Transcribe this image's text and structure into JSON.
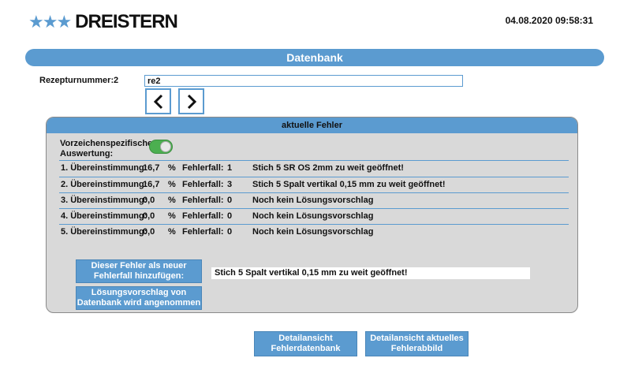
{
  "header": {
    "logo_stars": "★★★",
    "logo_text": "DREISTERN",
    "datetime": "04.08.2020 09:58:31"
  },
  "title": "Datenbank",
  "recipe": {
    "label": "Rezepturnummer:",
    "number": "2",
    "input_value": "re2"
  },
  "panel": {
    "title": "aktuelle Fehler",
    "sign_specific_label": "Vorzeichenspezifische Auswertung:",
    "toggle_on": true,
    "rows": [
      {
        "label": "1. Übereinstimmung:",
        "value": "16,7",
        "pct": "%",
        "ff_label": "Fehlerfall:",
        "ff_value": "1",
        "message": "Stich 5 SR OS 2mm zu weit geöffnet!"
      },
      {
        "label": "2. Übereinstimmung:",
        "value": "16,7",
        "pct": "%",
        "ff_label": "Fehlerfall:",
        "ff_value": "3",
        "message": "Stich 5 Spalt vertikal 0,15 mm zu weit geöffnet!"
      },
      {
        "label": "3. Übereinstimmung:",
        "value": "0,0",
        "pct": "%",
        "ff_label": "Fehlerfall:",
        "ff_value": "0",
        "message": "Noch kein Lösungsvorschlag"
      },
      {
        "label": "4. Übereinstimmung:",
        "value": "0,0",
        "pct": "%",
        "ff_label": "Fehlerfall:",
        "ff_value": "0",
        "message": "Noch kein Lösungsvorschlag"
      },
      {
        "label": "5. Übereinstimmung:",
        "value": "0,0",
        "pct": "%",
        "ff_label": "Fehlerfall:",
        "ff_value": "0",
        "message": "Noch kein Lösungsvorschlag"
      }
    ],
    "add_button": "Dieser Fehler als neuer Fehlerfall hinzufügen:",
    "accept_button": "Lösungsvorschlag von Datenbank wird angenommen",
    "fix_text": "Stich 5 Spalt vertikal 0,15 mm zu weit geöffnet!"
  },
  "footer": {
    "detail_db_button": "Detailansicht Fehlerdatenbank",
    "detail_img_button": "Detailansicht aktuelles Fehlerabbild"
  },
  "colors": {
    "accent": "#5b9bd0",
    "panel_bg": "#d9d9d9",
    "toggle_on": "#4caf50"
  },
  "icons": {
    "prev": "chevron-left-icon",
    "next": "chevron-right-icon"
  }
}
